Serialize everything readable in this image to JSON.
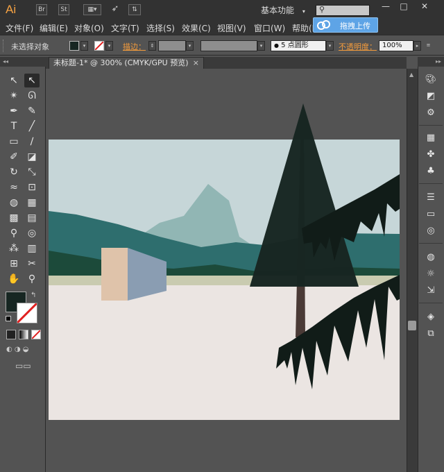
{
  "app": {
    "logo": "Ai",
    "titlebar_buttons": [
      "Br",
      "St"
    ],
    "workspace_label": "基本功能",
    "workspace_arrow": "▾",
    "search_icon": "search-icon",
    "window_controls": [
      "—",
      "□",
      "✕"
    ]
  },
  "menu": {
    "items": [
      "文件(F)",
      "编辑(E)",
      "对象(O)",
      "文字(T)",
      "选择(S)",
      "效果(C)",
      "视图(V)",
      "窗口(W)",
      "帮助(H)"
    ]
  },
  "upload_popup": {
    "label": "拖拽上传",
    "icon": "cloud-icon",
    "color": "#5ea4e6"
  },
  "control_bar": {
    "selection_label": "未选择对象",
    "stroke_label": "描边：",
    "brush_value": "5 点圆形",
    "opacity_label": "不透明度：",
    "opacity_value": "100%"
  },
  "document": {
    "tab_title": "未标题-1* @ 300% (CMYK/GPU 预览)",
    "close": "×"
  },
  "tools": {
    "items": [
      {
        "name": "selection-tool",
        "glyph": "↖"
      },
      {
        "name": "direct-selection-tool",
        "glyph": "↖",
        "active": true
      },
      {
        "name": "magic-wand-tool",
        "glyph": "✴"
      },
      {
        "name": "lasso-tool",
        "glyph": "ᘏ"
      },
      {
        "name": "pen-tool",
        "glyph": "✒"
      },
      {
        "name": "curvature-tool",
        "glyph": "✎"
      },
      {
        "name": "type-tool",
        "glyph": "T"
      },
      {
        "name": "line-tool",
        "glyph": "╱"
      },
      {
        "name": "rectangle-tool",
        "glyph": "▭"
      },
      {
        "name": "paintbrush-tool",
        "glyph": "∕"
      },
      {
        "name": "shaper-tool",
        "glyph": "✐"
      },
      {
        "name": "eraser-tool",
        "glyph": "◪"
      },
      {
        "name": "rotate-tool",
        "glyph": "↻"
      },
      {
        "name": "scale-tool",
        "glyph": "⤡"
      },
      {
        "name": "warp-tool",
        "glyph": "≈"
      },
      {
        "name": "free-transform-tool",
        "glyph": "⊡"
      },
      {
        "name": "shape-builder-tool",
        "glyph": "◍"
      },
      {
        "name": "perspective-grid-tool",
        "glyph": "▦"
      },
      {
        "name": "mesh-tool",
        "glyph": "▩"
      },
      {
        "name": "gradient-tool",
        "glyph": "▤"
      },
      {
        "name": "eyedropper-tool",
        "glyph": "⚲"
      },
      {
        "name": "blend-tool",
        "glyph": "◎"
      },
      {
        "name": "symbol-sprayer-tool",
        "glyph": "⁂"
      },
      {
        "name": "column-graph-tool",
        "glyph": "▥"
      },
      {
        "name": "artboard-tool",
        "glyph": "⊞"
      },
      {
        "name": "slice-tool",
        "glyph": "✂"
      },
      {
        "name": "hand-tool",
        "glyph": "✋"
      },
      {
        "name": "zoom-tool",
        "glyph": "⚲"
      }
    ],
    "fill_color": "#172622",
    "stroke_color": "none"
  },
  "right_panel": {
    "icons": [
      "color-icon",
      "color-guide-icon",
      "symbols-icon",
      "swatches-icon",
      "brushes-icon",
      "clubs-icon",
      "stroke-icon",
      "gradient-icon",
      "transparency-icon",
      "appearance-icon",
      "graphic-styles-icon",
      "export-icon",
      "layers-icon",
      "artboards-icon"
    ]
  },
  "artwork": {
    "sky": "#c6d6d8",
    "ground": "#ebe5e2",
    "mountain_light": "#91b6b4",
    "hills_teal": "#2e6e6e",
    "hills_dark": "#1c4a3a",
    "tree": "#172622",
    "trunk": "#4a3a36",
    "house_front": "#dfc3aa",
    "house_side": "#8a9db2"
  }
}
